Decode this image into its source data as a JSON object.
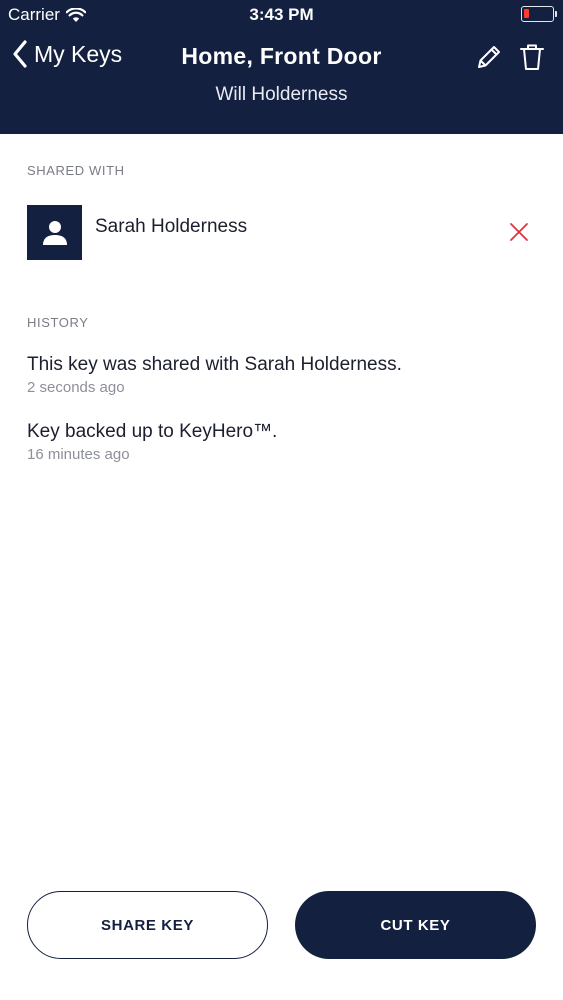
{
  "status_bar": {
    "carrier": "Carrier",
    "time": "3:43 PM",
    "battery_color": "#ff3b30"
  },
  "nav": {
    "back_label": "My Keys",
    "title": "Home, Front Door",
    "subtitle": "Will Holderness",
    "edit_icon": "pencil-icon",
    "delete_icon": "trash-icon"
  },
  "shared_with": {
    "label": "SHARED WITH",
    "users": [
      {
        "name": "Sarah Holderness",
        "remove_icon": "close-icon"
      }
    ]
  },
  "history": {
    "label": "HISTORY",
    "items": [
      {
        "text": "This key was shared with Sarah Holderness.",
        "time": "2 seconds ago"
      },
      {
        "text": "Key backed up to KeyHero™.",
        "time": "16 minutes ago"
      }
    ]
  },
  "actions": {
    "share_label": "SHARE KEY",
    "cut_label": "CUT KEY"
  },
  "colors": {
    "header_bg": "#14203f",
    "accent_red": "#e0333f"
  }
}
